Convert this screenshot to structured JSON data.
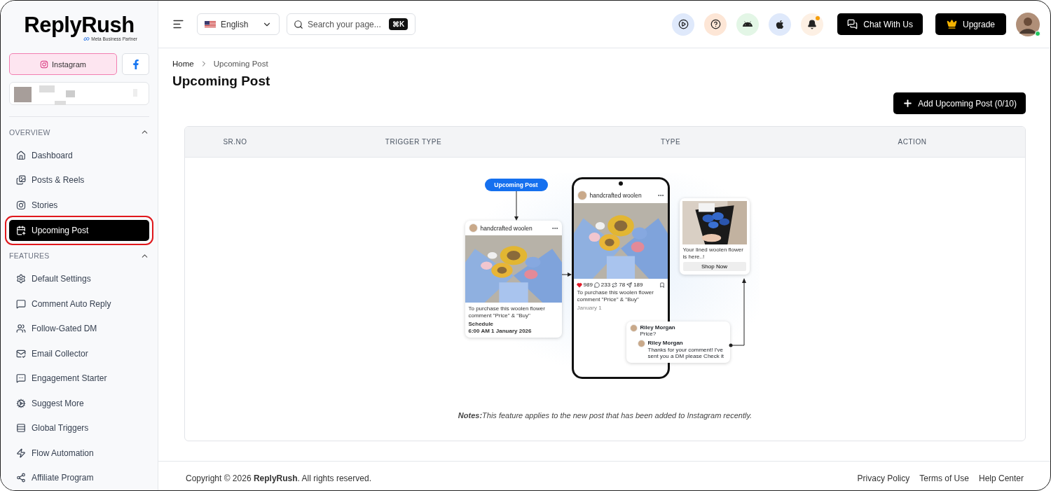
{
  "brand": {
    "name": "ReplyRush",
    "partner": "Meta Business Partner"
  },
  "platforms": [
    {
      "kind": "instagram",
      "label": "Instagram",
      "selected": true
    },
    {
      "kind": "facebook",
      "selected": false
    }
  ],
  "sidebar": {
    "sections": [
      {
        "title": "OVERVIEW",
        "expanded": true,
        "items": [
          {
            "label": "Dashboard",
            "selected": false,
            "highlighted": false
          },
          {
            "label": "Posts & Reels",
            "selected": false,
            "highlighted": false
          },
          {
            "label": "Stories",
            "selected": false,
            "highlighted": false
          },
          {
            "label": "Upcoming Post",
            "selected": true,
            "highlighted": true
          }
        ]
      },
      {
        "title": "FEATURES",
        "expanded": true,
        "items": [
          {
            "label": "Default Settings",
            "selected": false,
            "highlighted": false
          },
          {
            "label": "Comment Auto Reply",
            "selected": false,
            "highlighted": false
          },
          {
            "label": "Follow-Gated DM",
            "selected": false,
            "highlighted": false
          },
          {
            "label": "Email Collector",
            "selected": false,
            "highlighted": false
          },
          {
            "label": "Engagement Starter",
            "selected": false,
            "highlighted": false
          },
          {
            "label": "Suggest More",
            "selected": false,
            "highlighted": false
          },
          {
            "label": "Global Triggers",
            "selected": false,
            "highlighted": false
          },
          {
            "label": "Flow Automation",
            "selected": false,
            "highlighted": false
          },
          {
            "label": "Affiliate Program",
            "selected": false,
            "highlighted": false
          }
        ]
      }
    ]
  },
  "header": {
    "language": "English",
    "search": {
      "placeholder": "Search your page...",
      "shortcut": "⌘K"
    },
    "notification": true,
    "chat_button": "Chat With Us",
    "upgrade_button": "Upgrade",
    "online": true
  },
  "breadcrumb": [
    "Home",
    "Upcoming Post"
  ],
  "title": "Upcoming Post",
  "add_button": "Add Upcoming Post (0/10)",
  "table": {
    "columns": [
      "SR.NO",
      "TRIGGER TYPE",
      "TYPE",
      "ACTION"
    ]
  },
  "illustration": {
    "tag": "Upcoming Post",
    "scheduled_post": {
      "account": "handcrafted woolen",
      "caption": "To purchase this woolen flower comment \"Price\" & \"Buy\"",
      "schedule_label": "Schedule",
      "schedule_time": "6:00 AM 1 January 2026"
    },
    "live_post": {
      "account": "handcrafted woolen",
      "likes": "989",
      "comments": "233",
      "reposts": "78",
      "shares": "189",
      "caption": "To purchase this woolen flower comment \"Price\" & \"Buy\"",
      "date": "January 1"
    },
    "dm_card": {
      "message": "Your lined woolen flower is here..!",
      "button": "Shop Now"
    },
    "comments": [
      {
        "author": "Riley Morgan",
        "text": "Price?"
      },
      {
        "author": "Riley Morgan",
        "text": "Thanks for your comment! I've sent you a DM please Check it"
      }
    ]
  },
  "note": "**Notes:**This feature applies to the new post that has been added to Instagram recently.",
  "footer": {
    "copyright": "Copyright © 2026 **ReplyRush**. All rights reserved.",
    "links": [
      "Privacy Policy",
      "Terms of Use",
      "Help Center"
    ]
  }
}
